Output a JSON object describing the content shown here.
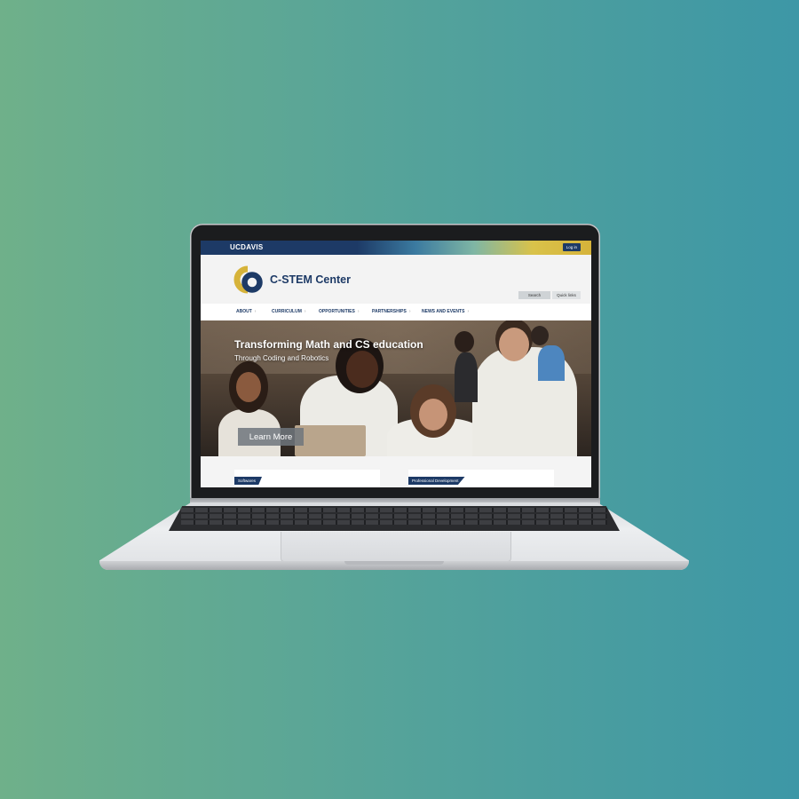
{
  "site": {
    "brand": "UCDAVIS",
    "login_label": "Log in",
    "title": "C-STEM Center",
    "search_label": "Search",
    "quicklinks_label": "Quick links"
  },
  "nav": {
    "items": [
      {
        "label": "ABOUT"
      },
      {
        "label": "CURRICULUM"
      },
      {
        "label": "OPPORTUNITIES"
      },
      {
        "label": "PARTNERSHIPS"
      },
      {
        "label": "NEWS AND EVENTS"
      }
    ],
    "chevron": "›"
  },
  "hero": {
    "title": "Transforming Math and CS education",
    "subtitle": "Through Coding and Robotics",
    "button_label": "Learn More"
  },
  "cards": [
    {
      "tag": "Softwares"
    },
    {
      "tag": "Professional Development"
    }
  ],
  "colors": {
    "navy": "#1d3a66",
    "gold": "#d6b33a"
  }
}
